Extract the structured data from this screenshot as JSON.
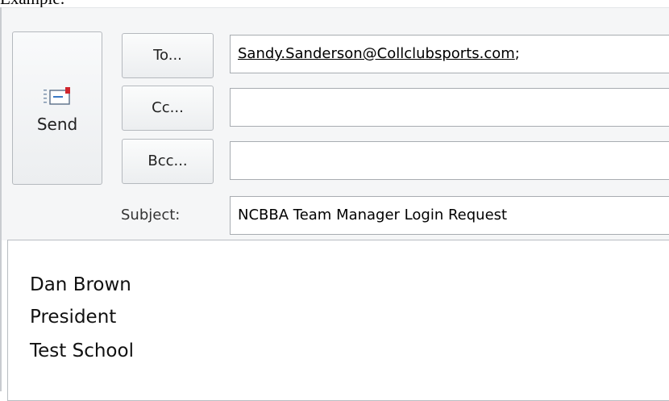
{
  "caption": "Example:",
  "send_button": {
    "label": "Send",
    "icon": "envelope-send-icon"
  },
  "address": {
    "to_label": "To...",
    "cc_label": "Cc...",
    "bcc_label": "Bcc...",
    "to_value": "Sandy.Sanderson@Collclubsports.com",
    "to_separator": ";",
    "cc_value": "",
    "bcc_value": ""
  },
  "subject": {
    "label": "Subject:",
    "value": "NCBBA Team Manager Login Request"
  },
  "body": {
    "lines": [
      "Dan Brown",
      "President",
      "Test School"
    ]
  },
  "colors": {
    "header_bg": "#f5f6f7",
    "envelope_flag": "#d0262d",
    "envelope_accent": "#3a78c4"
  }
}
